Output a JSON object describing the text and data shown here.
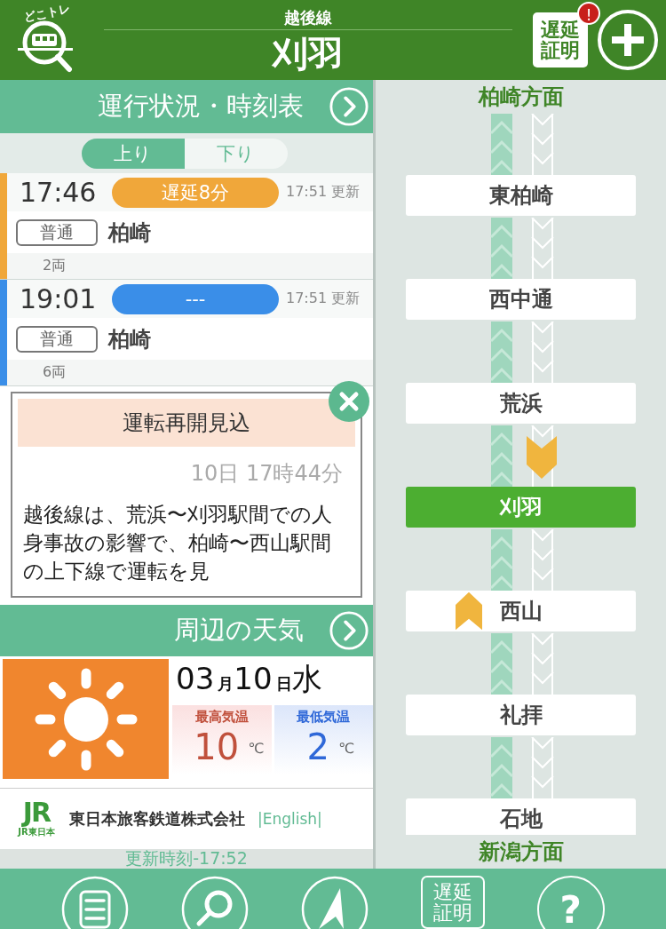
{
  "header": {
    "logo_text": "どこトレ",
    "line": "越後線",
    "station": "刈羽",
    "delay_cert_button": "遅延証明",
    "delay_cert_alert": "!"
  },
  "timetable": {
    "title": "運行状況・時刻表",
    "directions": [
      {
        "label": "上り",
        "selected": true
      },
      {
        "label": "下り",
        "selected": false
      }
    ],
    "trains": [
      {
        "time": "17:46",
        "status": "遅延8分",
        "color": "#f0a73a",
        "updated": "17:51 更新",
        "type": "普通",
        "destination": "柏崎",
        "cars": "2両"
      },
      {
        "time": "19:01",
        "status": "---",
        "color": "#3a8ee8",
        "updated": "17:51 更新",
        "type": "普通",
        "destination": "柏崎",
        "cars": "6両"
      }
    ]
  },
  "notice": {
    "title": "運転再開見込",
    "time": "10日 17時44分",
    "body": "越後線は、荒浜〜刈羽駅間での人身事故の影響で、柏崎〜西山駅間の上下線で運転を見"
  },
  "weather": {
    "title": "周辺の天気",
    "date": {
      "month": "03",
      "month_unit": "月",
      "day": "10",
      "day_unit": "日",
      "weekday": "水"
    },
    "high": {
      "label": "最高気温",
      "value": "10",
      "unit": "℃"
    },
    "low": {
      "label": "最低気温",
      "value": "2",
      "unit": "℃"
    }
  },
  "footer": {
    "logo_mark": "JR",
    "logo_sub": "JR東日本",
    "company": "東日本旅客鉄道株式会社",
    "english_link": "|English|",
    "updated": "更新時刻-17:52"
  },
  "route": {
    "top_direction": "柏崎方面",
    "bottom_direction": "新潟方面",
    "stations": [
      {
        "name": "東柏崎",
        "selected": false,
        "down_train_approaching": false,
        "up_train_at": false
      },
      {
        "name": "西中通",
        "selected": false,
        "down_train_approaching": false,
        "up_train_at": false
      },
      {
        "name": "荒浜",
        "selected": false,
        "down_train_approaching": false,
        "up_train_at": false
      },
      {
        "name": "刈羽",
        "selected": true,
        "down_train_approaching": true,
        "up_train_at": false
      },
      {
        "name": "西山",
        "selected": false,
        "down_train_approaching": false,
        "up_train_at": true
      },
      {
        "name": "礼拝",
        "selected": false,
        "down_train_approaching": false,
        "up_train_at": false
      },
      {
        "name": "石地",
        "selected": false,
        "down_train_approaching": false,
        "up_train_at": false
      }
    ]
  },
  "bottom_nav": [
    {
      "kind": "list"
    },
    {
      "kind": "search"
    },
    {
      "kind": "navigate"
    },
    {
      "kind": "certificate",
      "label": "遅延証明"
    },
    {
      "kind": "help",
      "label": "?"
    }
  ]
}
